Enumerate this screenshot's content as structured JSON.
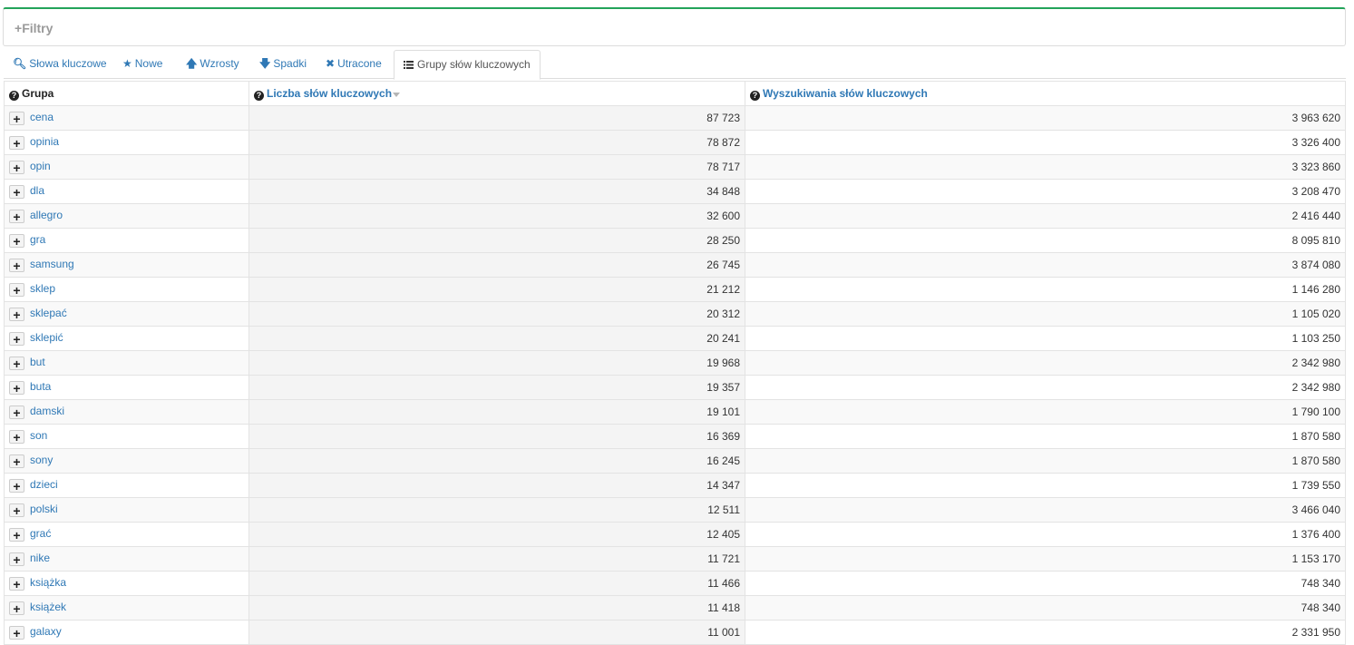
{
  "filters": {
    "label": "Filtry",
    "icon": "plus-icon"
  },
  "tabs": [
    {
      "label": "Słowa kluczowe",
      "icon": "search-icon",
      "glyph": "🔍︎"
    },
    {
      "label": "Nowe",
      "icon": "star-icon",
      "glyph": "★"
    },
    {
      "label": "Wzrosty",
      "icon": "arrow-up-icon",
      "glyph": "🡅"
    },
    {
      "label": "Spadki",
      "icon": "arrow-down-icon",
      "glyph": "🡇"
    },
    {
      "label": "Utracone",
      "icon": "close-icon",
      "glyph": "✖"
    },
    {
      "label": "Grupy słów kluczowych",
      "icon": "list-icon",
      "active": true
    }
  ],
  "table": {
    "headers": {
      "group": "Grupa",
      "count": "Liczba słów kluczowych",
      "searches": "Wyszukiwania słów kluczowych"
    },
    "sort": {
      "column": "count",
      "direction": "desc"
    },
    "rows": [
      {
        "group": "cena",
        "count": "87 723",
        "searches": "3 963 620"
      },
      {
        "group": "opinia",
        "count": "78 872",
        "searches": "3 326 400"
      },
      {
        "group": "opin",
        "count": "78 717",
        "searches": "3 323 860"
      },
      {
        "group": "dla",
        "count": "34 848",
        "searches": "3 208 470"
      },
      {
        "group": "allegro",
        "count": "32 600",
        "searches": "2 416 440"
      },
      {
        "group": "gra",
        "count": "28 250",
        "searches": "8 095 810"
      },
      {
        "group": "samsung",
        "count": "26 745",
        "searches": "3 874 080"
      },
      {
        "group": "sklep",
        "count": "21 212",
        "searches": "1 146 280"
      },
      {
        "group": "sklepać",
        "count": "20 312",
        "searches": "1 105 020"
      },
      {
        "group": "sklepić",
        "count": "20 241",
        "searches": "1 103 250"
      },
      {
        "group": "but",
        "count": "19 968",
        "searches": "2 342 980"
      },
      {
        "group": "buta",
        "count": "19 357",
        "searches": "2 342 980"
      },
      {
        "group": "damski",
        "count": "19 101",
        "searches": "1 790 100"
      },
      {
        "group": "son",
        "count": "16 369",
        "searches": "1 870 580"
      },
      {
        "group": "sony",
        "count": "16 245",
        "searches": "1 870 580"
      },
      {
        "group": "dzieci",
        "count": "14 347",
        "searches": "1 739 550"
      },
      {
        "group": "polski",
        "count": "12 511",
        "searches": "3 466 040"
      },
      {
        "group": "grać",
        "count": "12 405",
        "searches": "1 376 400"
      },
      {
        "group": "nike",
        "count": "11 721",
        "searches": "1 153 170"
      },
      {
        "group": "książka",
        "count": "11 466",
        "searches": "748 340"
      },
      {
        "group": "książek",
        "count": "11 418",
        "searches": "748 340"
      },
      {
        "group": "galaxy",
        "count": "11 001",
        "searches": "2 331 950"
      }
    ]
  },
  "colors": {
    "accent": "#23a35a",
    "link": "#2f78b5"
  }
}
